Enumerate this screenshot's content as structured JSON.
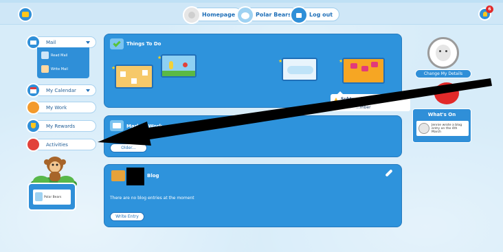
{
  "topbar": {
    "homepage_label": "Homepage",
    "class_label": "Polar Bears",
    "logout_label": "Log out",
    "notification_count": "6"
  },
  "nav": {
    "mail": "Mail",
    "read_mail": "Read Mail",
    "write_mail": "Write Mail",
    "calendar": "My Calendar",
    "work": "My Work",
    "rewards": "My Rewards",
    "activities": "Activities"
  },
  "class_card": {
    "label": "Polar Bears"
  },
  "things_to_do": {
    "title": "Things To Do",
    "tooltip_lines": [
      "Subtraction of Single",
      "Digit N..."
    ],
    "tooltip_tail": "...mber"
  },
  "marked_work": {
    "title": "Marked Work",
    "older_button": "Older..."
  },
  "blog": {
    "title": "Blog",
    "empty_text": "There are no blog entries at the moment",
    "write_button": "Write Entry"
  },
  "profile": {
    "change_button": "Change My Details"
  },
  "whats_on": {
    "title": "What's On",
    "entry_lines": [
      "Jennie wrote a blog",
      "entry on the 4th March"
    ]
  },
  "colors": {
    "accent": "#2f8fd8",
    "panel": "#2e93dc",
    "background": "#d7ecf9"
  }
}
